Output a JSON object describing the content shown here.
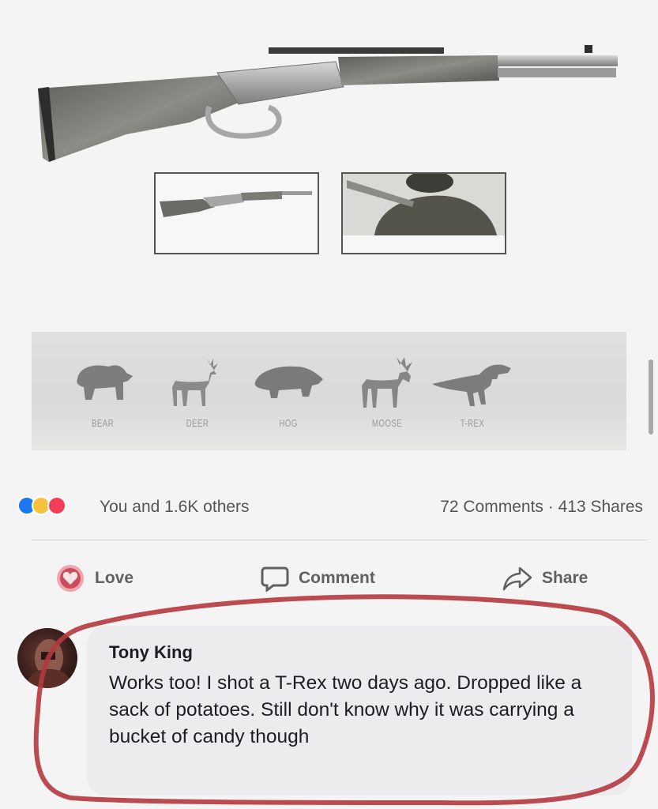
{
  "product": {
    "thumbnails": [
      "rifle-thumbnail",
      "hunter-thumbnail"
    ]
  },
  "animals": [
    {
      "label": "BEAR",
      "icon": "bear-icon"
    },
    {
      "label": "DEER",
      "icon": "deer-icon"
    },
    {
      "label": "HOG",
      "icon": "hog-icon"
    },
    {
      "label": "MOOSE",
      "icon": "moose-icon"
    },
    {
      "label": "T-REX",
      "icon": "trex-icon"
    }
  ],
  "post": {
    "reactions_text": "You and 1.6K others",
    "counts_text": "72 Comments · 413 Shares",
    "actions": {
      "love": "Love",
      "comment": "Comment",
      "share": "Share"
    }
  },
  "comment": {
    "author": "Tony King",
    "text": "Works too! I shot a T-Rex two days ago. Dropped like a sack of potatoes. Still don't know why it was carrying a bucket of candy though"
  },
  "colors": {
    "like": "#1a78f2",
    "haha": "#f5c33b",
    "love": "#f33e58",
    "highlight": "#b5383f"
  }
}
